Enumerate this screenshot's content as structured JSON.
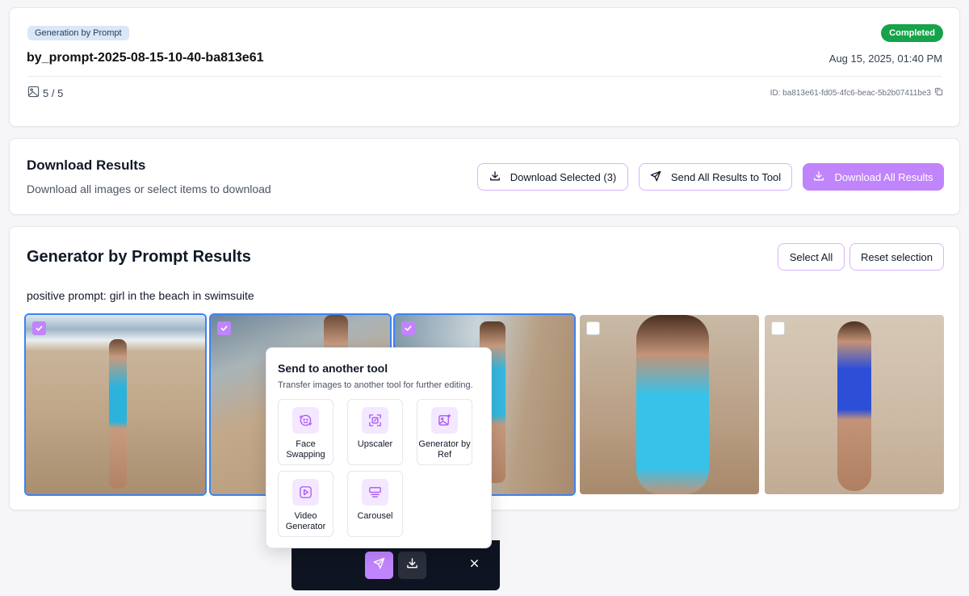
{
  "info": {
    "type_badge": "Generation by Prompt",
    "status": "Completed",
    "title": "by_prompt-2025-08-15-10-40-ba813e61",
    "date": "Aug 15, 2025, 01:40 PM",
    "count": "5 / 5",
    "id": "ID: ba813e61-fd05-4fc6-beac-5b2b07411be3"
  },
  "download": {
    "title": "Download Results",
    "subtitle": "Download all images or select items to download",
    "selected_label": "Download Selected (3)",
    "send_all_label": "Send All Results to Tool",
    "download_all_label": "Download All Results"
  },
  "results": {
    "title": "Generator by Prompt Results",
    "select_all_label": "Select All",
    "reset_label": "Reset selection",
    "prompt": "positive prompt: girl in the beach in swimsuite",
    "images": [
      {
        "selected": true
      },
      {
        "selected": true
      },
      {
        "selected": true
      },
      {
        "selected": false
      },
      {
        "selected": false
      }
    ]
  },
  "popup": {
    "title": "Send to another tool",
    "subtitle": "Transfer images to another tool for further editing.",
    "tools": [
      {
        "label": "Face Swapping",
        "icon": "face-swap-icon"
      },
      {
        "label": "Upscaler",
        "icon": "upscale-icon"
      },
      {
        "label": "Generator by Ref",
        "icon": "image-sparkle-icon"
      },
      {
        "label": "Video Generator",
        "icon": "video-play-icon"
      },
      {
        "label": "Carousel",
        "icon": "carousel-icon"
      }
    ]
  },
  "colors": {
    "accent": "#c084fc",
    "status_green": "#16a34a",
    "selection_blue": "#3b82f6"
  }
}
